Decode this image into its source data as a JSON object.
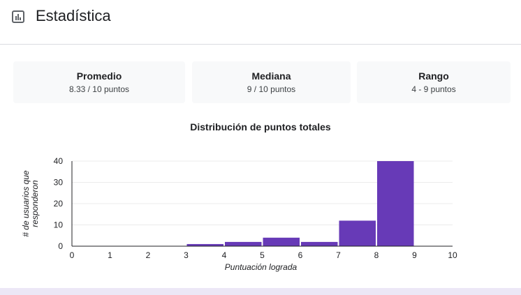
{
  "header": {
    "title": "Estadística",
    "icon": "bar-chart-icon"
  },
  "stats": [
    {
      "label": "Promedio",
      "value": "8.33 / 10 puntos"
    },
    {
      "label": "Mediana",
      "value": "9 / 10 puntos"
    },
    {
      "label": "Rango",
      "value": "4 - 9 puntos"
    }
  ],
  "chart_title": "Distribución de puntos totales",
  "chart_data": {
    "type": "bar",
    "title": "Distribución de puntos totales",
    "xlabel": "Puntuación lograda",
    "ylabel_lines": [
      "# de usuarios que",
      "responderon"
    ],
    "x_ticks": [
      "0",
      "1",
      "2",
      "3",
      "4",
      "5",
      "6",
      "7",
      "8",
      "9",
      "10"
    ],
    "y_ticks": [
      "0",
      "10",
      "20",
      "30",
      "40"
    ],
    "ylim": [
      0,
      40
    ],
    "xlim": [
      0,
      10
    ],
    "bars": [
      {
        "x": 4,
        "value": 1
      },
      {
        "x": 5,
        "value": 2
      },
      {
        "x": 6,
        "value": 4
      },
      {
        "x": 7,
        "value": 2
      },
      {
        "x": 8,
        "value": 12
      },
      {
        "x": 9,
        "value": 40
      }
    ],
    "bar_color": "#673ab7",
    "grid": true
  }
}
